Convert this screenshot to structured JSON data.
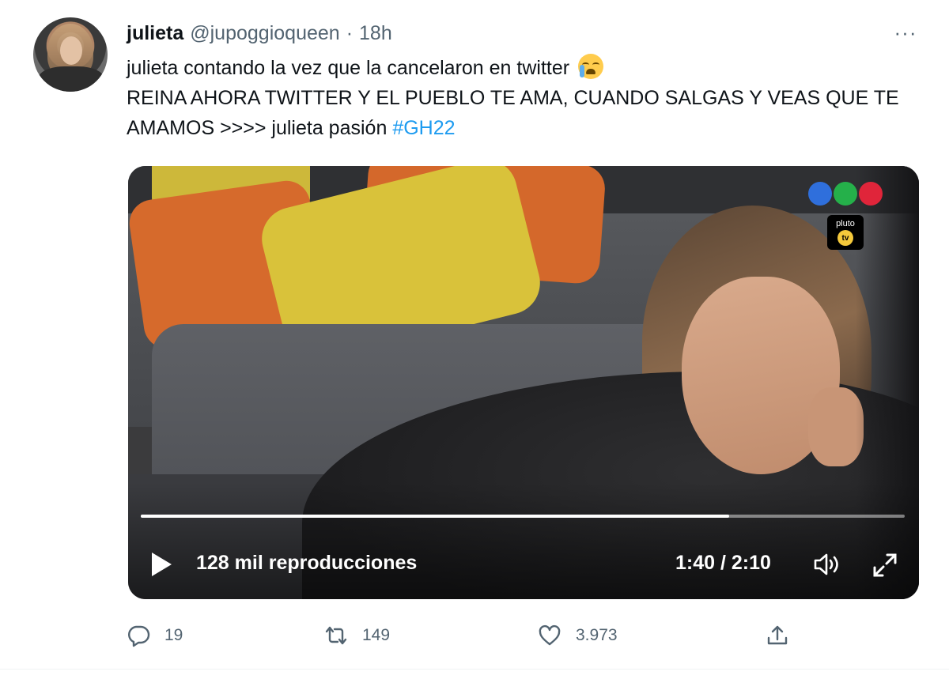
{
  "tweet": {
    "display_name": "julieta",
    "handle": "@jupoggioqueen",
    "separator": "·",
    "time": "18h",
    "more_label": "···",
    "text_line1": "julieta contando la vez que la cancelaron en twitter",
    "text_line2": "REINA AHORA TWITTER Y EL PUEBLO TE AMA, CUANDO SALGAS Y VEAS QUE TE AMAMOS >>>> julieta pasión",
    "hashtag": "#GH22",
    "emoji": "loudly-crying-face"
  },
  "video": {
    "views": "128 mil reproducciones",
    "timecode": "1:40 / 2:10",
    "progress": 0.77,
    "watermark_text": "pluto",
    "watermark_tv": "tv",
    "logo_colors": [
      "#2f6fdc",
      "#25b04a",
      "#e0253a"
    ]
  },
  "actions": {
    "replies": "19",
    "retweets": "149",
    "likes": "3.973"
  },
  "colors": {
    "link": "#1d9bf0",
    "secondary_text": "#536471",
    "text": "#0f1419"
  }
}
